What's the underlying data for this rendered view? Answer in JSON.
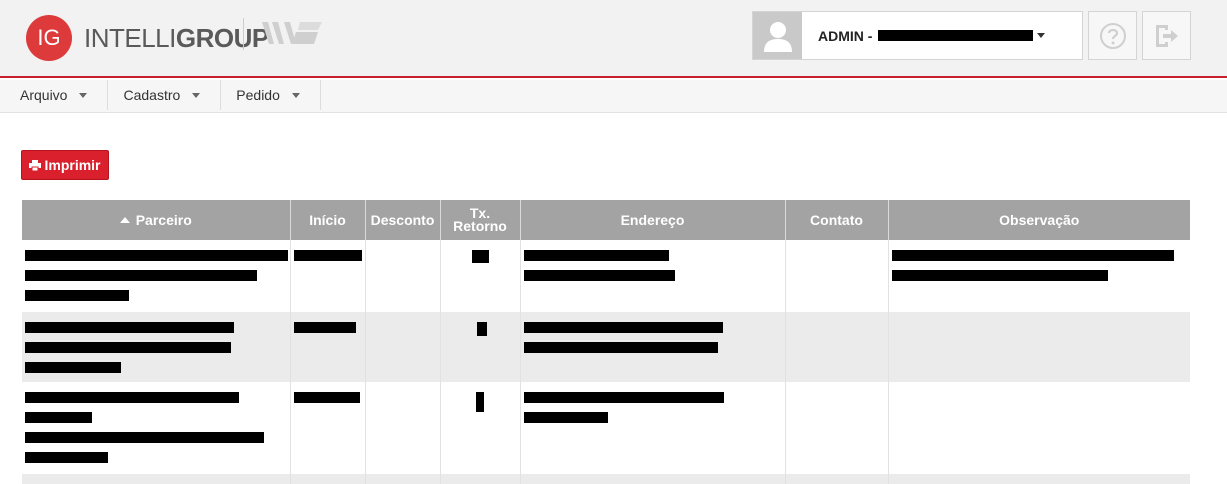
{
  "header": {
    "logo_badge": "IG",
    "logo_text_light": "INTELLI",
    "logo_text_bold": "GROUP",
    "user_label": "ADMIN -"
  },
  "menu": {
    "items": [
      {
        "label": "Arquivo"
      },
      {
        "label": "Cadastro"
      },
      {
        "label": "Pedido"
      }
    ]
  },
  "toolbar": {
    "print_label": "Imprimir"
  },
  "table": {
    "headers": {
      "parceiro": "Parceiro",
      "inicio": "Início",
      "desconto": "Desconto",
      "tx_retorno_1": "Tx.",
      "tx_retorno_2": "Retorno",
      "endereco": "Endereço",
      "contato": "Contato",
      "observacao": "Observação"
    },
    "sort_column": "parceiro",
    "sort_direction": "asc"
  },
  "colors": {
    "accent": "#d9202c",
    "header_bg": "#f2f2f2",
    "table_header": "#a3a3a3",
    "row_alt": "#ebebeb"
  }
}
